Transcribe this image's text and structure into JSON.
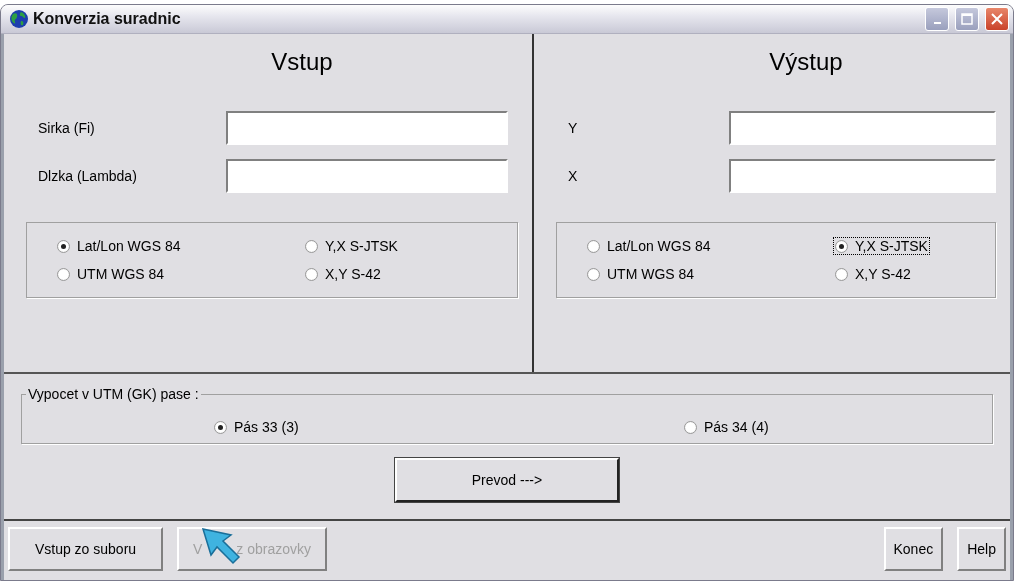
{
  "window": {
    "title": "Konverzia suradnic"
  },
  "input_panel": {
    "heading": "Vstup",
    "fields": [
      {
        "label": "Sirka (Fi)"
      },
      {
        "label": "Dlzka (Lambda)"
      }
    ],
    "options": [
      {
        "label": "Lat/Lon WGS 84",
        "selected": true,
        "focused": false
      },
      {
        "label": "Y,X S-JTSK",
        "selected": false,
        "focused": false
      },
      {
        "label": "UTM WGS 84",
        "selected": false,
        "focused": false
      },
      {
        "label": "X,Y S-42",
        "selected": false,
        "focused": false
      }
    ]
  },
  "output_panel": {
    "heading": "Výstup",
    "fields": [
      {
        "label": "Y"
      },
      {
        "label": "X"
      }
    ],
    "options": [
      {
        "label": "Lat/Lon WGS 84",
        "selected": false,
        "focused": false
      },
      {
        "label": "Y,X S-JTSK",
        "selected": true,
        "focused": true
      },
      {
        "label": "UTM WGS 84",
        "selected": false,
        "focused": false
      },
      {
        "label": "X,Y S-42",
        "selected": false,
        "focused": false
      }
    ]
  },
  "zone_group": {
    "legend": "Vypocet v UTM (GK) pase :",
    "options": [
      {
        "label": "Pás 33 (3)",
        "selected": true
      },
      {
        "label": "Pás 34 (4)",
        "selected": false
      }
    ]
  },
  "convert_button": {
    "label": "Prevod --->"
  },
  "left_buttons": [
    {
      "label": "Vstup zo suboru",
      "disabled": false
    },
    {
      "label_parts": [
        "V",
        "z obrazovky"
      ],
      "disabled": true
    }
  ],
  "right_buttons": [
    {
      "label": "Konec",
      "disabled": false
    },
    {
      "label": "Help",
      "disabled": false
    }
  ]
}
